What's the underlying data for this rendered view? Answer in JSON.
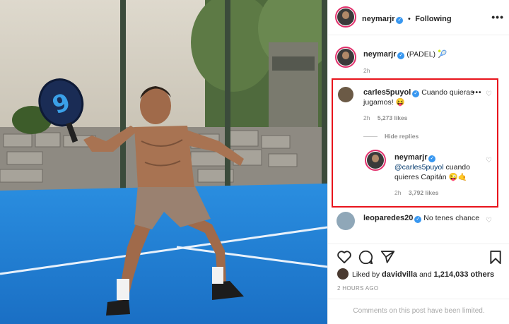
{
  "post": {
    "author": "neymarjr",
    "follow_status": "Following",
    "separator": "•",
    "more_label": "•••"
  },
  "caption": {
    "author": "neymarjr",
    "text": "(PADEL) 🎾",
    "time": "2h"
  },
  "comments": [
    {
      "author": "carles5puyol",
      "text": "Cuando quieras jugamos! 😝",
      "time": "2h",
      "likes": "5,273 likes",
      "hide_replies": "Hide replies"
    },
    {
      "author": "neymarjr",
      "mention": "@carles5puyol",
      "text": "cuando quieres Capitán 😜🤙",
      "time": "2h",
      "likes": "3,792 likes"
    },
    {
      "author": "leoparedes20",
      "text": "No tenes chance"
    }
  ],
  "likes_line": {
    "prefix": "Liked by",
    "user": "davidvilla",
    "connector": "and",
    "count": "1,214,033 others"
  },
  "timestamp": "2 HOURS AGO",
  "footer_text": "Comments on this post have been limited.",
  "icons": {
    "like": "heart-icon",
    "comment": "comment-icon",
    "share": "paper-plane-icon",
    "save": "bookmark-icon"
  },
  "colors": {
    "highlight_border": "#e8141c",
    "verified_badge": "#3897f0",
    "court_blue": "#1f7fd6",
    "story_ring": "#e1306c"
  }
}
